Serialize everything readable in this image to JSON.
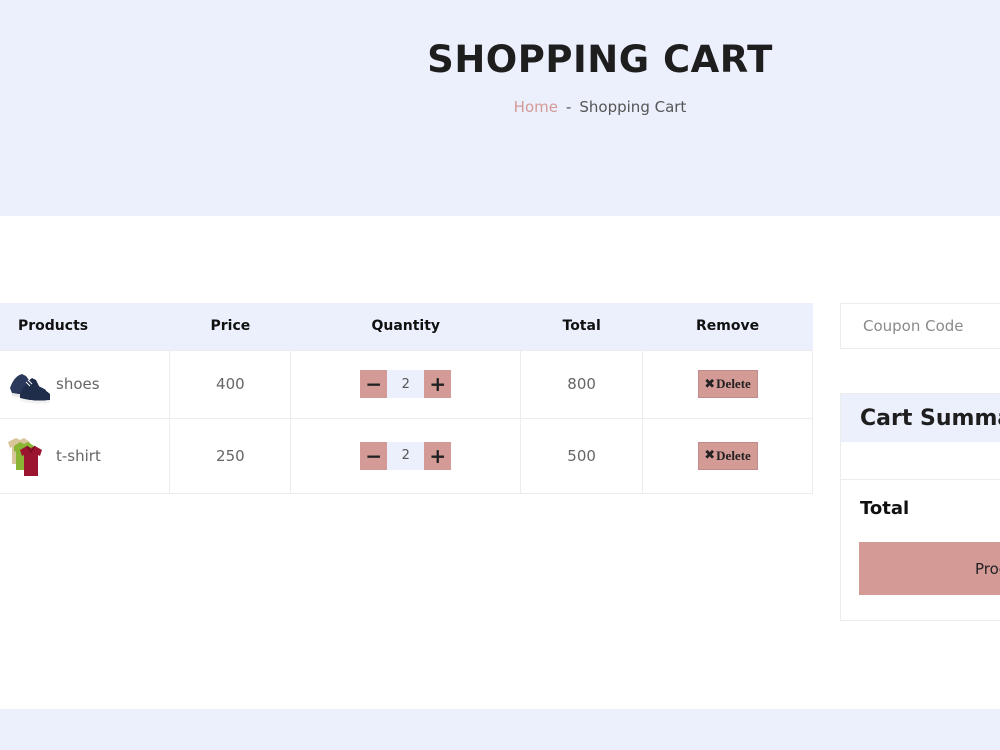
{
  "hero": {
    "title": "SHOPPING CART",
    "breadcrumb": {
      "home": "Home",
      "separator": "-",
      "current": "Shopping Cart"
    }
  },
  "cart": {
    "headers": [
      "Products",
      "Price",
      "Quantity",
      "Total",
      "Remove"
    ],
    "rows": [
      {
        "name": "shoes",
        "price": "400",
        "qty": "2",
        "total": "800",
        "image_icon": "shoes-image"
      },
      {
        "name": "t-shirt",
        "price": "250",
        "qty": "2",
        "total": "500",
        "image_icon": "t-shirt-image"
      }
    ],
    "minus_glyph": "−",
    "plus_glyph": "+",
    "delete_icon_glyph": "✖",
    "delete_label": "Delete"
  },
  "coupon": {
    "placeholder": "Coupon Code"
  },
  "summary": {
    "title": "Cart Summary",
    "total_label": "Total",
    "proceed_label": "Proceed To Checkout"
  },
  "colors": {
    "accent": "#d39a96",
    "band": "#ecf0fd",
    "border": "#ececec",
    "text": "#1e1e1e"
  }
}
